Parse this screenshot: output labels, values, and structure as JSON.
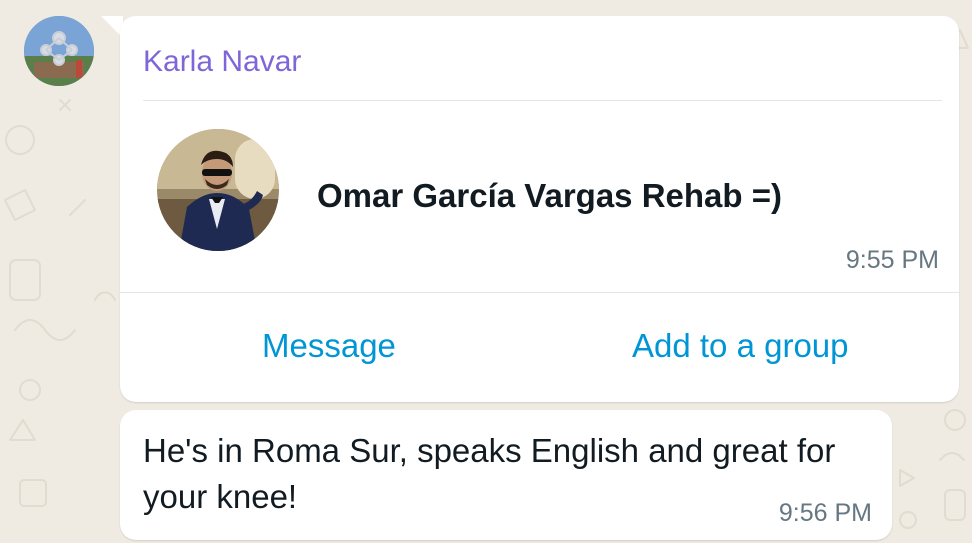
{
  "chat": {
    "sender_name": "Karla Navar",
    "contact_card": {
      "contact_name": "Omar García Vargas Rehab =)",
      "time": "9:55 PM",
      "actions": {
        "message": "Message",
        "add_to_group": "Add to a group"
      }
    },
    "text_message": {
      "text": "He's in Roma Sur, speaks English and great for your knee!",
      "time": "9:56 PM"
    }
  },
  "colors": {
    "background": "#efeae2",
    "bubble": "#ffffff",
    "sender_name": "#7f66d8",
    "action_link": "#0096d6",
    "text": "#111b21",
    "timestamp": "#667781"
  },
  "icons": {
    "sender_avatar": "avatar-image",
    "contact_photo": "contact-photo-image"
  }
}
